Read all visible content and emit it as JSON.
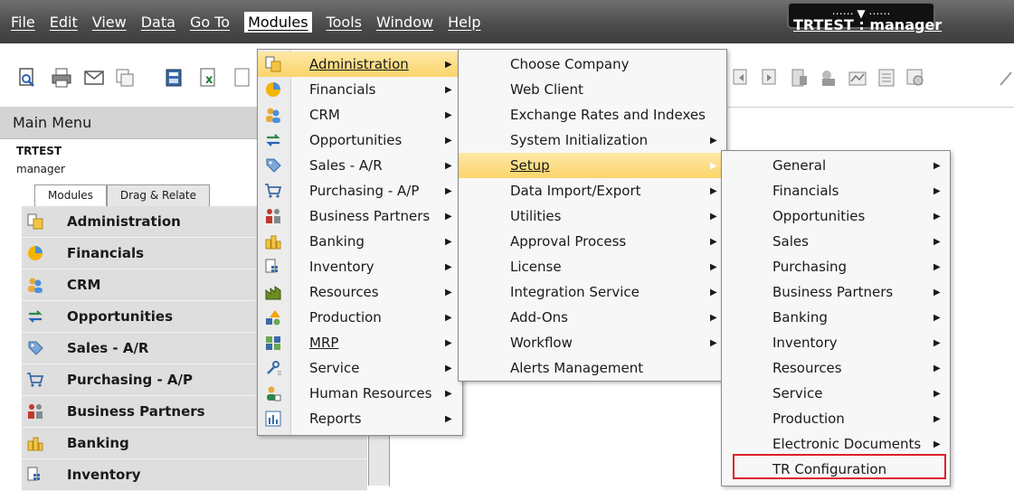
{
  "menubar": {
    "items": [
      "File",
      "Edit",
      "View",
      "Data",
      "Go To",
      "Modules",
      "Tools",
      "Window",
      "Help"
    ],
    "window_title": "TRTEST : manager"
  },
  "main_menu": {
    "header": "Main Menu",
    "company": "TRTEST",
    "user": "manager",
    "tabs": [
      "Modules",
      "Drag & Relate"
    ],
    "items": [
      {
        "label": "Administration",
        "icon": "administration-icon"
      },
      {
        "label": "Financials",
        "icon": "financials-icon"
      },
      {
        "label": "CRM",
        "icon": "crm-icon"
      },
      {
        "label": "Opportunities",
        "icon": "opportunities-icon"
      },
      {
        "label": "Sales - A/R",
        "icon": "sales-icon"
      },
      {
        "label": "Purchasing - A/P",
        "icon": "purchasing-icon"
      },
      {
        "label": "Business Partners",
        "icon": "business-partners-icon"
      },
      {
        "label": "Banking",
        "icon": "banking-icon"
      },
      {
        "label": "Inventory",
        "icon": "inventory-icon"
      }
    ]
  },
  "modules_menu": {
    "items": [
      "Administration",
      "Financials",
      "CRM",
      "Opportunities",
      "Sales - A/R",
      "Purchasing - A/P",
      "Business Partners",
      "Banking",
      "Inventory",
      "Resources",
      "Production",
      "MRP",
      "Service",
      "Human Resources",
      "Reports"
    ]
  },
  "admin_menu": {
    "items": [
      "Choose Company",
      "Web Client",
      "Exchange Rates and Indexes",
      "System Initialization",
      "Setup",
      "Data Import/Export",
      "Utilities",
      "Approval Process",
      "License",
      "Integration Service",
      "Add-Ons",
      "Workflow",
      "Alerts Management"
    ]
  },
  "setup_menu": {
    "items": [
      "General",
      "Financials",
      "Opportunities",
      "Sales",
      "Purchasing",
      "Business Partners",
      "Banking",
      "Inventory",
      "Resources",
      "Service",
      "Production",
      "Electronic Documents",
      "TR Configuration"
    ]
  },
  "colors": {
    "highlight": "#fcd46a",
    "callout": "#d9222a"
  }
}
